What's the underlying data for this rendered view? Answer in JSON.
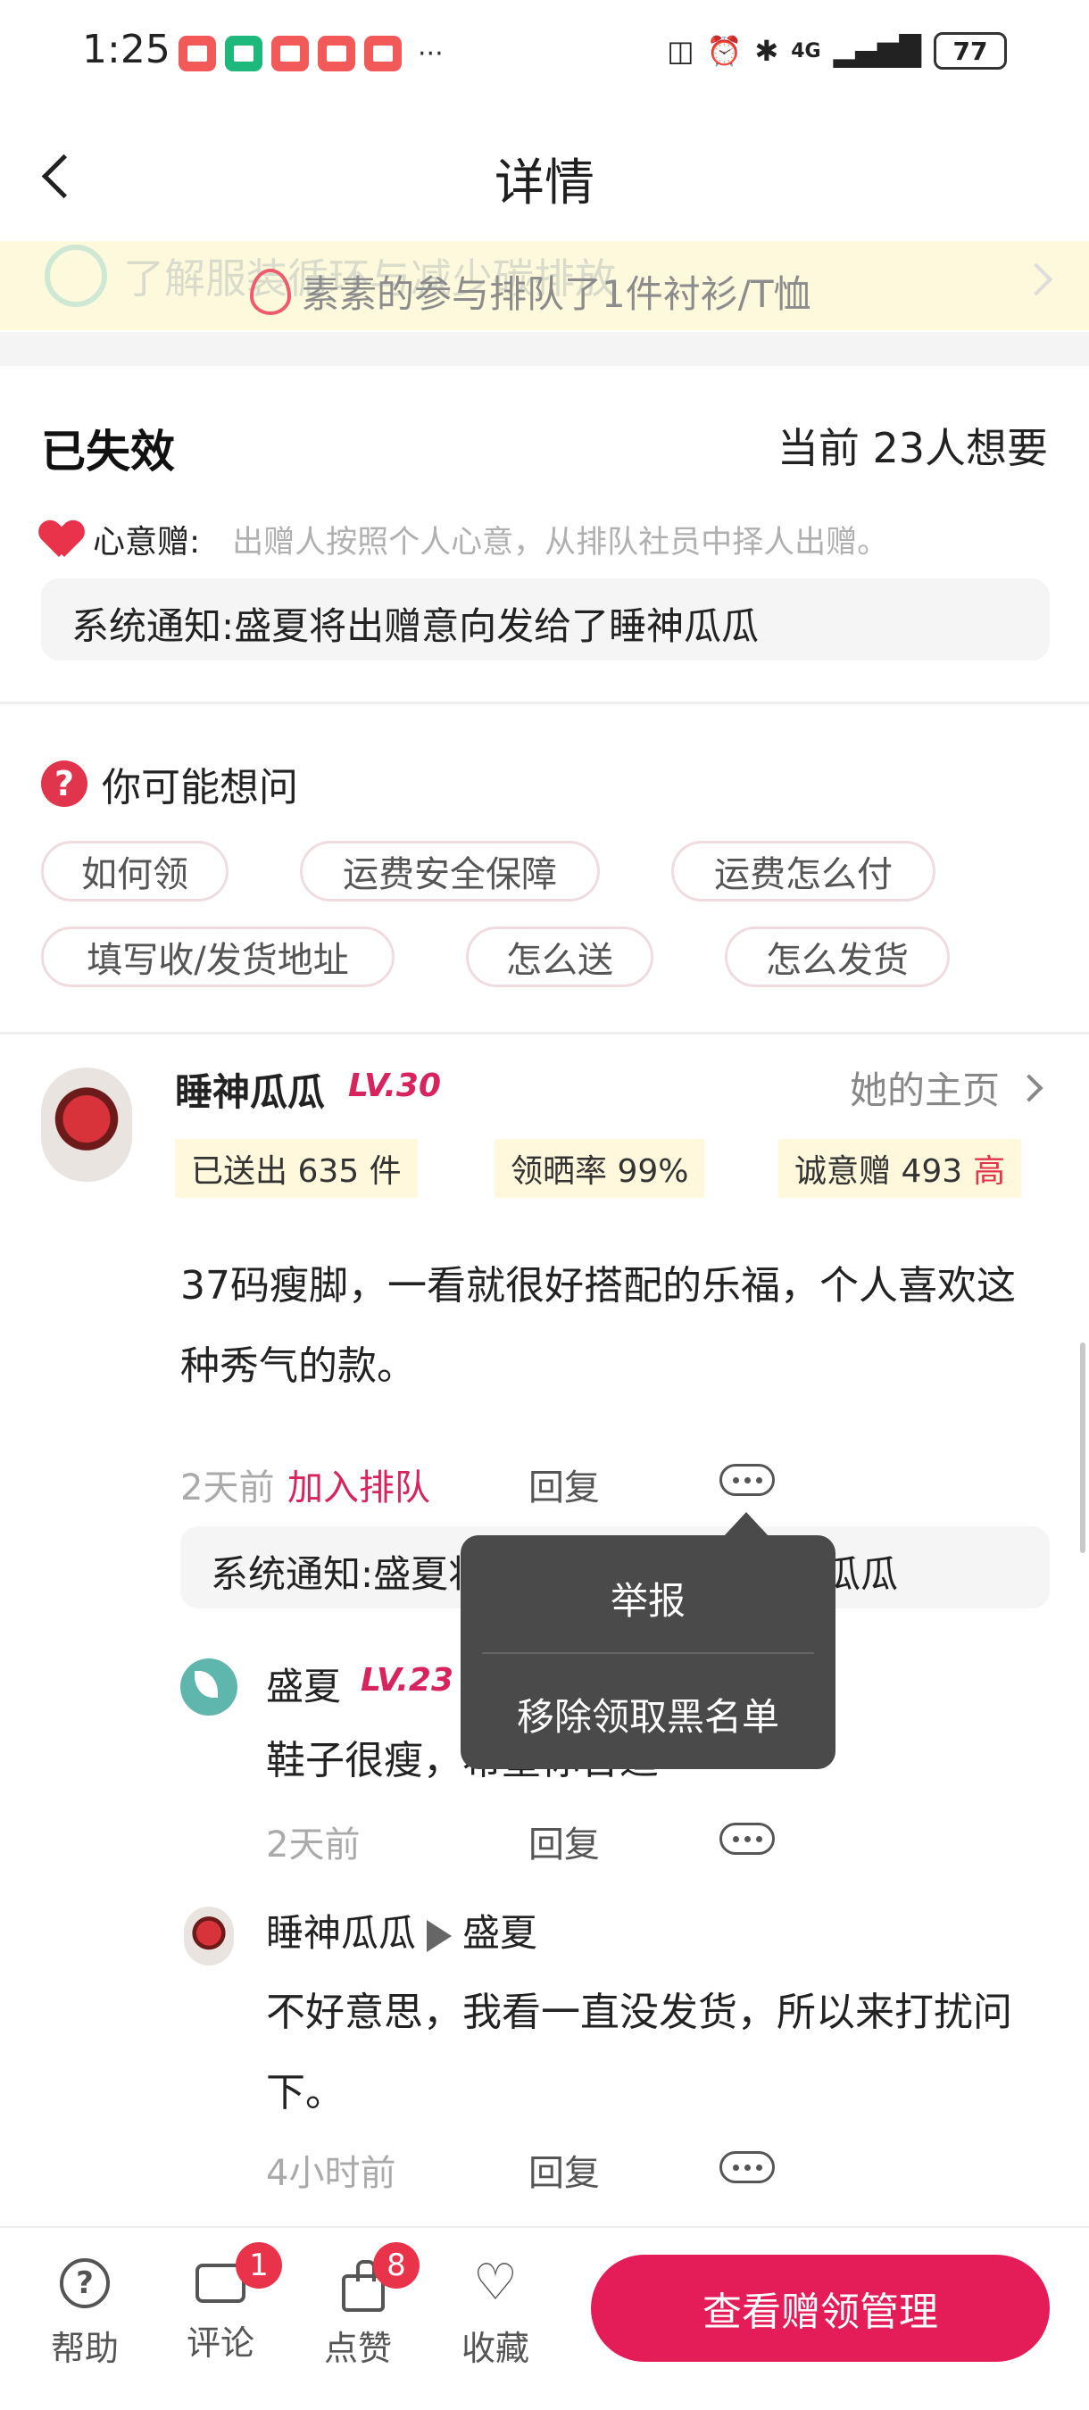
{
  "status_bar": {
    "time": "1:25",
    "dots": "···",
    "network": "4G",
    "battery": "77"
  },
  "nav": {
    "title": "详情"
  },
  "banner": {
    "ghost_text": "了解服装循环与减少碳排放",
    "text": "素素的参与排队了1件衬衫/T恤"
  },
  "status": {
    "title": "已失效",
    "wanted": "当前 23人想要",
    "heart_label": "心意赠:",
    "heart_desc": "出赠人按照个人心意，从排队社员中择人出赠。",
    "system_notice": "系统通知:盛夏将出赠意向发给了睡神瓜瓜"
  },
  "faq": {
    "title": "你可能想问",
    "tags": [
      "如何领",
      "运费安全保障",
      "运费怎么付",
      "填写收/发货地址",
      "怎么送",
      "怎么发货"
    ]
  },
  "post": {
    "username": "睡神瓜瓜",
    "level": "LV.30",
    "homepage": "她的主页",
    "stats": {
      "sent": "已送出 635 件",
      "show_rate": "领晒率 99%",
      "sincerity": "诚意赠 493",
      "sincerity_level": "高"
    },
    "text": "37码瘦脚，一看就很好搭配的乐福，个人喜欢这种秀气的款。",
    "time": "2天前",
    "join": "加入排队",
    "reply": "回复",
    "system_notice": "系统通知:盛夏将出赠意向发给了睡神瓜瓜"
  },
  "replies": [
    {
      "username": "盛夏",
      "level": "LV.23",
      "text": "鞋子很瘦，希望你合适",
      "time": "2天前",
      "reply": "回复"
    },
    {
      "username": "睡神瓜瓜",
      "to": "盛夏",
      "text": "不好意思，我看一直没发货，所以来打扰问下。",
      "time": "4小时前",
      "reply": "回复"
    }
  ],
  "popup_menu": {
    "items": [
      "举报",
      "移除领取黑名单"
    ]
  },
  "bottom_bar": {
    "help": "帮助",
    "comment": "评论",
    "comment_badge": "1",
    "like": "点赞",
    "like_badge": "8",
    "favorite": "收藏",
    "cta": "查看赠领管理"
  },
  "colors": {
    "accent": "#e41d58",
    "level": "#d8245c",
    "banner_bg": "#fdf9dc",
    "stat_bg": "#fff8dc"
  }
}
